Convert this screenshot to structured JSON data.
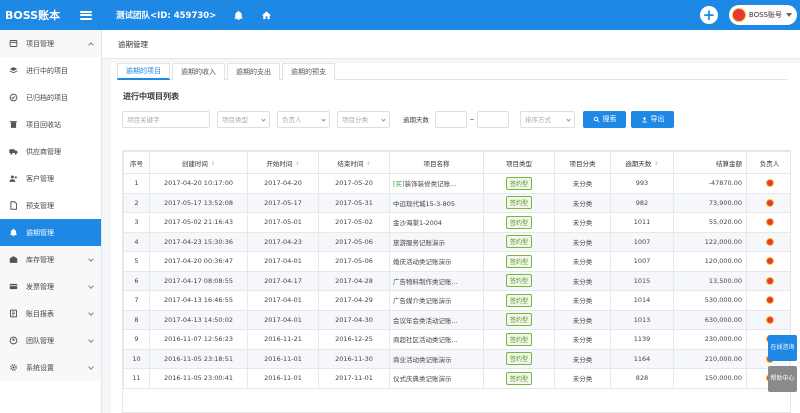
{
  "brand": "BOSS账本",
  "team": "测试团队<ID: 459730>",
  "account_label": "BOSS账号",
  "sidebar": {
    "items": [
      {
        "label": "项目管理",
        "icon": "folder-icon",
        "type": "group-open"
      },
      {
        "label": "进行中的项目",
        "icon": "layers-icon"
      },
      {
        "label": "已归档的项目",
        "icon": "check-circle-icon"
      },
      {
        "label": "项目回收站",
        "icon": "recycle-bin-icon"
      },
      {
        "label": "供应商管理",
        "icon": "truck-icon"
      },
      {
        "label": "客户管理",
        "icon": "users-icon"
      },
      {
        "label": "预支管理",
        "icon": "document-icon"
      },
      {
        "label": "逾期管理",
        "icon": "bell-icon",
        "active": true
      },
      {
        "label": "库存管理",
        "icon": "warehouse-icon",
        "type": "group"
      },
      {
        "label": "发票管理",
        "icon": "invoice-icon",
        "type": "group"
      },
      {
        "label": "账目报表",
        "icon": "report-icon",
        "type": "group"
      },
      {
        "label": "团队管理",
        "icon": "team-icon",
        "type": "group"
      },
      {
        "label": "系统设置",
        "icon": "gear-icon",
        "type": "group"
      }
    ]
  },
  "page_title": "逾期管理",
  "tabs": [
    "逾期的项目",
    "逾期的收入",
    "逾期的支出",
    "逾期的预支"
  ],
  "section_title": "进行中项目列表",
  "filters": {
    "keyword_placeholder": "项目关键字",
    "type_placeholder": "项目类型",
    "owner_placeholder": "负责人",
    "category_placeholder": "项目分类",
    "overdue_label": "逾期天数",
    "sort_placeholder": "排序方式",
    "search_label": "搜索",
    "export_label": "导出"
  },
  "table": {
    "headers": [
      "序号",
      "创建时间",
      "开始时间",
      "结束时间",
      "项目名称",
      "项目类型",
      "项目分类",
      "逾期天数",
      "结算金额",
      "负责人"
    ],
    "rows": [
      {
        "no": "1",
        "created": "2017-04-20 10:17:00",
        "start": "2017-04-20",
        "end": "2017-05-20",
        "tag": "[买]",
        "name": "装饰装修类记账...",
        "type": "签约型",
        "category": "未分类",
        "days": "993",
        "amount": "-47870.00"
      },
      {
        "no": "2",
        "created": "2017-05-17 13:52:08",
        "start": "2017-05-17",
        "end": "2017-05-31",
        "tag": "",
        "name": "中远现代城15-3-805",
        "type": "签约型",
        "category": "未分类",
        "days": "982",
        "amount": "73,900.00"
      },
      {
        "no": "3",
        "created": "2017-05-02 21:16:43",
        "start": "2017-05-01",
        "end": "2017-05-02",
        "tag": "",
        "name": "金沙海棠1-2004",
        "type": "签约型",
        "category": "未分类",
        "days": "1011",
        "amount": "55,020.00"
      },
      {
        "no": "4",
        "created": "2017-04-23 15:30:36",
        "start": "2017-04-23",
        "end": "2017-05-06",
        "tag": "",
        "name": "旅游服务记账演示",
        "type": "签约型",
        "category": "未分类",
        "days": "1007",
        "amount": "122,000.00"
      },
      {
        "no": "5",
        "created": "2017-04-20 00:36:47",
        "start": "2017-04-01",
        "end": "2017-05-06",
        "tag": "",
        "name": "婚庆活动类记账演示",
        "type": "签约型",
        "category": "未分类",
        "days": "1007",
        "amount": "120,000.00"
      },
      {
        "no": "6",
        "created": "2017-04-17 08:08:55",
        "start": "2017-04-17",
        "end": "2017-04-28",
        "tag": "",
        "name": "广告物料制作类记账...",
        "type": "签约型",
        "category": "未分类",
        "days": "1015",
        "amount": "13,500.00"
      },
      {
        "no": "7",
        "created": "2017-04-13 16:46:55",
        "start": "2017-04-01",
        "end": "2017-04-29",
        "tag": "",
        "name": "广告媒介类记账演示",
        "type": "签约型",
        "category": "未分类",
        "days": "1014",
        "amount": "530,000.00"
      },
      {
        "no": "8",
        "created": "2017-04-13 14:50:02",
        "start": "2017-04-01",
        "end": "2017-04-30",
        "tag": "",
        "name": "会议年会类活动记账...",
        "type": "签约型",
        "category": "未分类",
        "days": "1013",
        "amount": "630,000.00"
      },
      {
        "no": "9",
        "created": "2016-11-07 12:56:23",
        "start": "2016-11-21",
        "end": "2016-12-25",
        "tag": "",
        "name": "商超社区活动类记账...",
        "type": "签约型",
        "category": "未分类",
        "days": "1139",
        "amount": "230,000.00"
      },
      {
        "no": "10",
        "created": "2016-11-05 23:18:51",
        "start": "2016-11-01",
        "end": "2016-11-30",
        "tag": "",
        "name": "商业活动类记账演示",
        "type": "签约型",
        "category": "未分类",
        "days": "1164",
        "amount": "210,000.00"
      },
      {
        "no": "11",
        "created": "2016-11-05 23:00:41",
        "start": "2016-11-01",
        "end": "2017-11-01",
        "tag": "",
        "name": "仪式庆典类记账演示",
        "type": "签约型",
        "category": "未分类",
        "days": "828",
        "amount": "150,000.00"
      }
    ]
  },
  "float": {
    "online_label": "在线咨询",
    "help_label": "帮助中心"
  },
  "colors": {
    "primary": "#1e88e5",
    "tag_green": "#558b2f",
    "help_grey": "#8a8a8a"
  }
}
